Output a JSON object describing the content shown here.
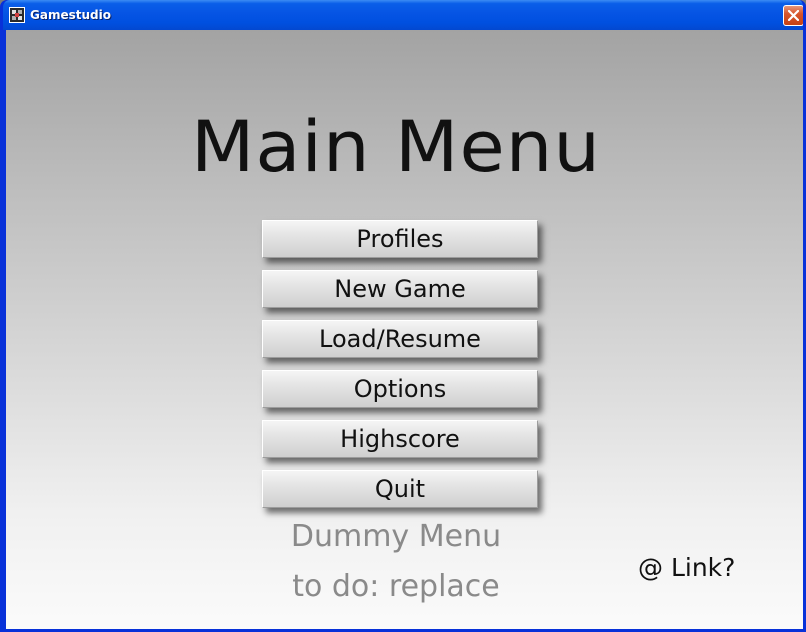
{
  "window": {
    "title": "Gamestudio",
    "app_icon": "gamestudio-app-icon",
    "close_icon": "close-x-icon",
    "titlebar_color": "#0654e4",
    "close_button_color": "#d8562d"
  },
  "main": {
    "heading": "Main Menu",
    "menu_items": [
      {
        "label": "Profiles"
      },
      {
        "label": "New Game"
      },
      {
        "label": "Load/Resume"
      },
      {
        "label": "Options"
      },
      {
        "label": "Highscore"
      },
      {
        "label": "Quit"
      }
    ],
    "note_line_1": "Dummy Menu",
    "note_line_2": "to do: replace",
    "link": "@ Link?"
  }
}
